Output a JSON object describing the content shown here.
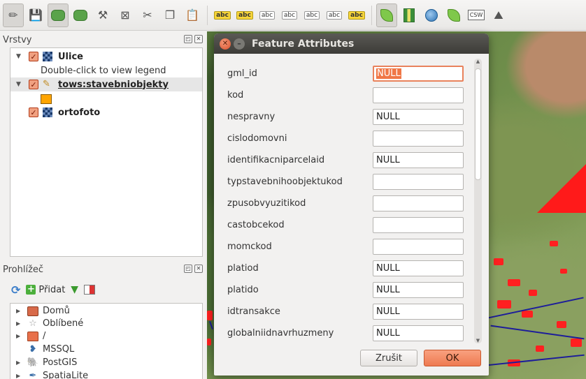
{
  "toolbar": {
    "icons": [
      "pencil-edit-icon",
      "save-edits-icon",
      "add-feature-icon",
      "move-feature-icon",
      "node-tool-icon",
      "delete-selected-icon",
      "cut-features-icon",
      "copy-features-icon",
      "paste-features-icon",
      "label-icon",
      "pin-label-icon",
      "show-hide-label-icon",
      "move-label-icon",
      "rotate-label-icon",
      "change-label-icon",
      "plugin-icon",
      "grass-icon",
      "add-wms-icon",
      "add-wfs-icon",
      "csw-icon",
      "mountain-icon"
    ],
    "abc_label": "abc",
    "csw_label": "CSW"
  },
  "layers_panel": {
    "title": "Vrstvy",
    "items": [
      {
        "name": "Ulice",
        "legend_hint": "Double-click to view legend"
      },
      {
        "name": "tows:stavebniobjekty",
        "symbol_color": "#ffa500"
      },
      {
        "name": "ortofoto"
      }
    ]
  },
  "browser_panel": {
    "title": "Prohlížeč",
    "add_label": "Přidat",
    "items": [
      {
        "label": "Domů"
      },
      {
        "label": "Oblíbené"
      },
      {
        "label": "/"
      },
      {
        "label": "MSSQL"
      },
      {
        "label": "PostGIS"
      },
      {
        "label": "SpatiaLite"
      }
    ]
  },
  "dialog": {
    "title": "Feature Attributes",
    "fields": [
      {
        "label": "gml_id",
        "value": "NULL"
      },
      {
        "label": "kod",
        "value": ""
      },
      {
        "label": "nespravny",
        "value": "NULL"
      },
      {
        "label": "cislodomovni",
        "value": ""
      },
      {
        "label": "identifikacniparcelaid",
        "value": "NULL"
      },
      {
        "label": "typstavebnihoobjektukod",
        "value": ""
      },
      {
        "label": "zpusobvyuzitikod",
        "value": ""
      },
      {
        "label": "castobcekod",
        "value": ""
      },
      {
        "label": "momckod",
        "value": ""
      },
      {
        "label": "platiod",
        "value": "NULL"
      },
      {
        "label": "platido",
        "value": "NULL"
      },
      {
        "label": "idtransakce",
        "value": "NULL"
      },
      {
        "label": "globalniidnavrhuzmeny",
        "value": "NULL"
      }
    ],
    "cancel_label": "Zrušit",
    "ok_label": "OK"
  },
  "colors": {
    "accent": "#ee7a51",
    "map_feature": "#ff2020"
  }
}
